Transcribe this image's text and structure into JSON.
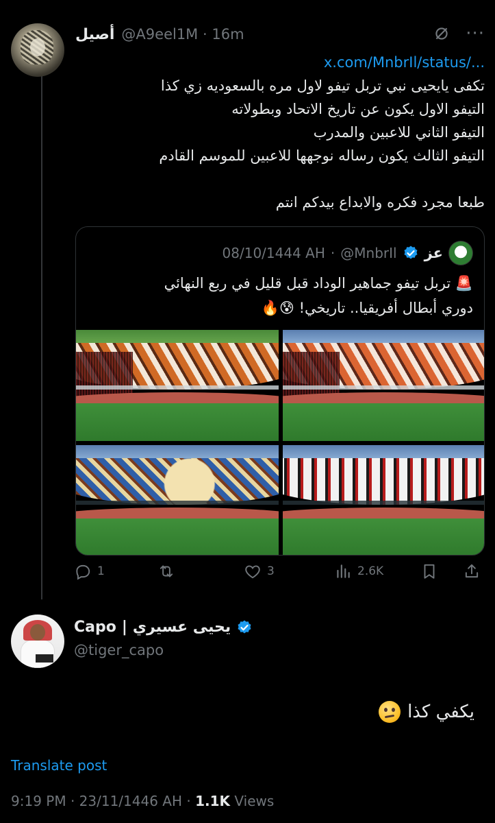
{
  "post": {
    "display_name": "أصيل",
    "handle": "@A9eel1M",
    "time": "16m",
    "meta_sep": "·",
    "link": "x.com/MnbrIl/status/...",
    "lines": [
      "تكفى يايحيى نبي تربل تيفو لاول مره بالسعوديه زي كذا",
      "التيفو الاول يكون عن تاريخ الاتحاد وبطولاته",
      "التيفو الثاني للاعبين والمدرب",
      "التيفو الثالث يكون رساله نوجهها للاعبين للموسم القادم"
    ],
    "last_line": "طبعا مجرد فكره والابداع بيدكم انتم",
    "icons": [
      "grok-icon",
      "more-icon"
    ]
  },
  "quote": {
    "display_name": "عز",
    "handle": "@MnbrIl",
    "date": "08/10/1444 AH",
    "sep": "·",
    "line1": "🚨 تربل تيفو جماهير الوداد قبل قليل في ربع النهائي",
    "line2": "دوري أبطال أفريقيا.. تاريخي! 😰🔥",
    "images": [
      "tifo-photo-1",
      "tifo-photo-2",
      "tifo-photo-3",
      "tifo-photo-4"
    ]
  },
  "actions": {
    "replies": "1",
    "reposts": "",
    "likes": "3",
    "views": "2.6K"
  },
  "reply": {
    "name_latin": "Capo",
    "name_sep": "|",
    "name_arabic": "يحيى عسيري",
    "handle": "@tiger_capo",
    "text": "يكفي كذا",
    "translate_label": "Translate post",
    "time": "9:19 PM",
    "date": "23/11/1446 AH",
    "views_count": "1.1K",
    "views_label": "Views",
    "sep": "·"
  },
  "colors": {
    "background": "#000000",
    "text": "#e7e9ea",
    "muted": "#71767b",
    "link": "#1d9bf0",
    "border": "#2f3336"
  }
}
